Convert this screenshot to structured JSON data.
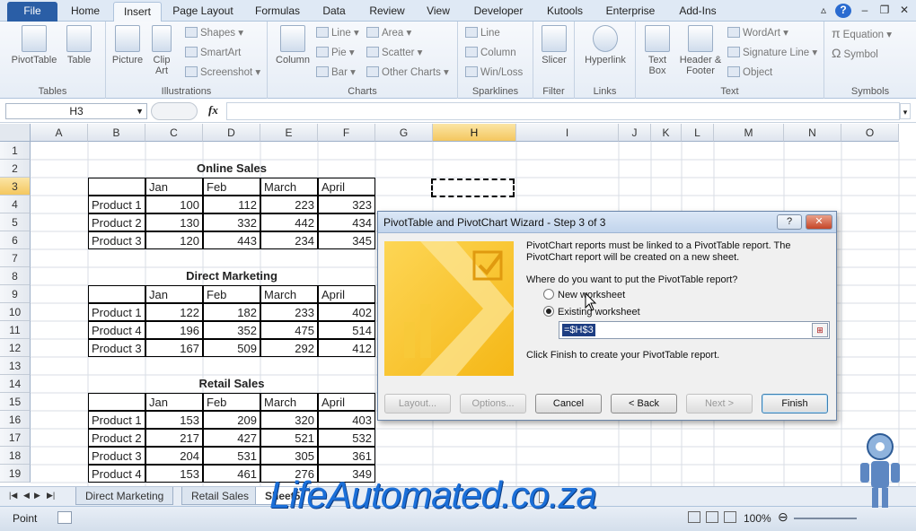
{
  "ribbon_tabs": [
    "File",
    "Home",
    "Insert",
    "Page Layout",
    "Formulas",
    "Data",
    "Review",
    "View",
    "Developer",
    "Kutools",
    "Enterprise",
    "Add-Ins"
  ],
  "active_tab": "Insert",
  "ribbon": {
    "tables": {
      "label": "Tables",
      "pivot": "PivotTable",
      "table": "Table"
    },
    "illustrations": {
      "label": "Illustrations",
      "picture": "Picture",
      "clipart": "Clip Art",
      "shapes": "Shapes",
      "smartart": "SmartArt",
      "screenshot": "Screenshot"
    },
    "charts": {
      "label": "Charts",
      "column": "Column",
      "line": "Line",
      "pie": "Pie",
      "bar": "Bar",
      "area": "Area",
      "scatter": "Scatter",
      "other": "Other Charts"
    },
    "sparklines": {
      "label": "Sparklines",
      "line": "Line",
      "column": "Column",
      "winloss": "Win/Loss"
    },
    "filter": {
      "label": "Filter",
      "slicer": "Slicer"
    },
    "links": {
      "label": "Links",
      "hyperlink": "Hyperlink"
    },
    "text": {
      "label": "Text",
      "textbox": "Text Box",
      "headerfooter": "Header & Footer",
      "wordart": "WordArt",
      "signature": "Signature Line",
      "object": "Object"
    },
    "symbols": {
      "label": "Symbols",
      "equation": "Equation",
      "symbol": "Symbol"
    }
  },
  "name_box": "H3",
  "fx_label": "fx",
  "columns": [
    "A",
    "B",
    "C",
    "D",
    "E",
    "F",
    "G",
    "H",
    "I",
    "J",
    "K",
    "L",
    "M",
    "N",
    "O"
  ],
  "rows": [
    "1",
    "2",
    "3",
    "4",
    "5",
    "6",
    "7",
    "8",
    "9",
    "10",
    "11",
    "12",
    "13",
    "14",
    "15",
    "16",
    "17",
    "18",
    "19"
  ],
  "months": [
    "Jan",
    "Feb",
    "March",
    "April"
  ],
  "tables": [
    {
      "title": "Online Sales",
      "rows": [
        [
          "Product 1",
          "100",
          "112",
          "223",
          "323"
        ],
        [
          "Product 2",
          "130",
          "332",
          "442",
          "434"
        ],
        [
          "Product 3",
          "120",
          "443",
          "234",
          "345"
        ]
      ]
    },
    {
      "title": "Direct Marketing",
      "rows": [
        [
          "Product 1",
          "122",
          "182",
          "233",
          "402"
        ],
        [
          "Product 4",
          "196",
          "352",
          "475",
          "514"
        ],
        [
          "Product 3",
          "167",
          "509",
          "292",
          "412"
        ]
      ]
    },
    {
      "title": "Retail Sales",
      "rows": [
        [
          "Product 1",
          "153",
          "209",
          "320",
          "403"
        ],
        [
          "Product 2",
          "217",
          "427",
          "521",
          "532"
        ],
        [
          "Product 3",
          "204",
          "531",
          "305",
          "361"
        ],
        [
          "Product 4",
          "153",
          "461",
          "276",
          "349"
        ]
      ]
    }
  ],
  "sheet_tabs": [
    "Direct Marketing",
    "Retail Sales",
    "Sheet5"
  ],
  "status": {
    "mode": "Point",
    "zoom": "100%"
  },
  "watermark": "LifeAutomated.co.za",
  "dialog": {
    "title": "PivotTable and PivotChart Wizard - Step 3 of 3",
    "help": "?",
    "close": "✕",
    "info1": "PivotChart reports must be linked to a PivotTable report.  The",
    "info2": "PivotChart report will be created on a new sheet.",
    "question": "Where do you want to put the PivotTable report?",
    "opt_new": "New worksheet",
    "opt_existing": "Existing worksheet",
    "ref": "=$H$3",
    "finish_note": "Click Finish to create your PivotTable report.",
    "btn_layout": "Layout...",
    "btn_options": "Options...",
    "btn_cancel": "Cancel",
    "btn_back": "< Back",
    "btn_next": "Next >",
    "btn_finish": "Finish"
  },
  "colors": {
    "accent": "#2a5ea6",
    "selection": "#f4c75f",
    "watermark": "#1b6fd8"
  }
}
